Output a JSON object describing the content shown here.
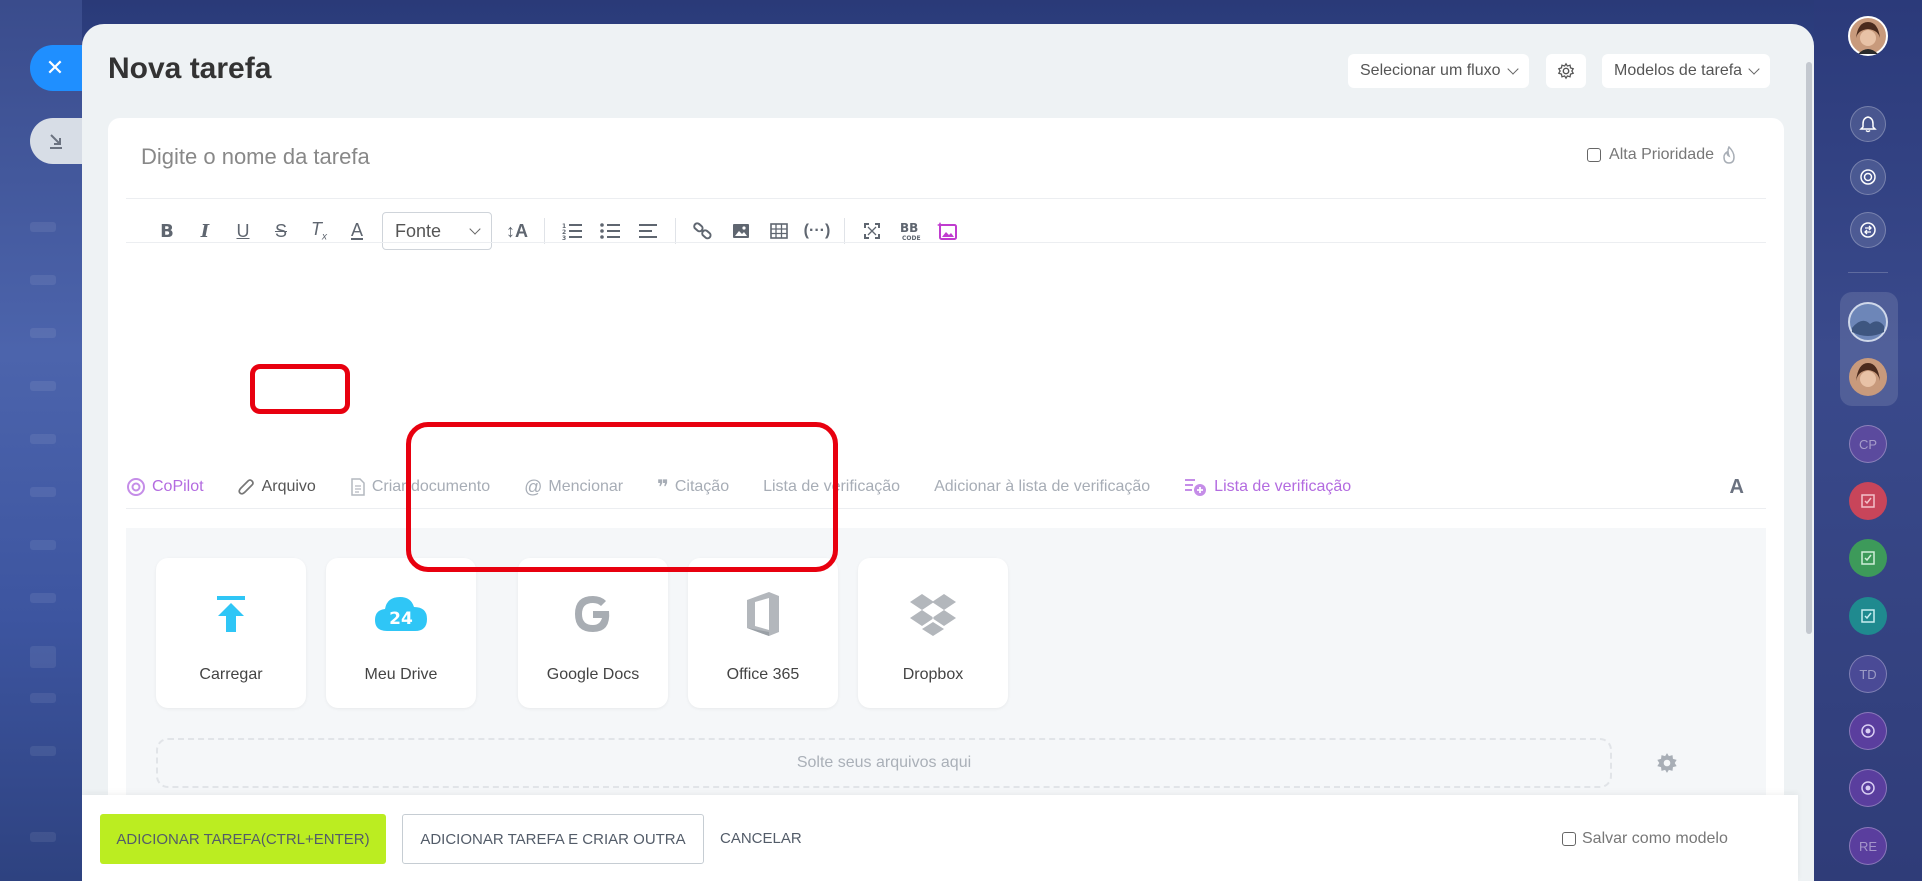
{
  "window": {
    "title": "Nova tarefa"
  },
  "header": {
    "flow_select": "Selecionar um fluxo",
    "templates": "Modelos de tarefa"
  },
  "task": {
    "name_placeholder": "Digite o nome da tarefa",
    "high_priority": "Alta Prioridade"
  },
  "toolbar": {
    "font_select": "Fonte",
    "buttons": [
      "bold-icon",
      "italic-icon",
      "underline-icon",
      "strikethrough-icon",
      "clear-format-icon",
      "text-color-icon",
      "font-size-icon",
      "numbered-list-icon",
      "bullet-list-icon",
      "align-icon",
      "link-icon",
      "image-icon",
      "table-icon",
      "code-icon",
      "fullscreen-icon",
      "bbcode-icon",
      "ai-image-icon"
    ]
  },
  "tabs": {
    "copilot": "CoPilot",
    "arquivo": "Arquivo",
    "criar_documento": "Criar documento",
    "mencionar": "Mencionar",
    "citacao": "Citação",
    "lista_verificacao": "Lista de verificação",
    "adicionar_lista": "Adicionar à lista de verificação",
    "lista_verificacao_2": "Lista de verificação",
    "font_toggle": "A"
  },
  "files": {
    "tiles": {
      "carregar": "Carregar",
      "meu_drive": "Meu Drive",
      "meu_drive_badge": "24",
      "google_docs": "Google Docs",
      "office365": "Office 365",
      "dropbox": "Dropbox"
    },
    "drop_text": "Solte seus arquivos aqui"
  },
  "footer": {
    "add_task": "ADICIONAR TAREFA(CTRL+ENTER)",
    "add_and_create": "ADICIONAR TAREFA E CRIAR OUTRA",
    "cancel": "CANCELAR",
    "save_as_template": "Salvar como modelo"
  },
  "right_bar": {
    "badges": [
      "CP",
      "TD",
      "RE"
    ]
  },
  "colors": {
    "accent_blue": "#1f8fff",
    "primary_button": "#bbed21",
    "highlight_red": "#e8000f",
    "copilot_purple": "#b36be0",
    "upload_cyan": "#2fc6f6"
  }
}
